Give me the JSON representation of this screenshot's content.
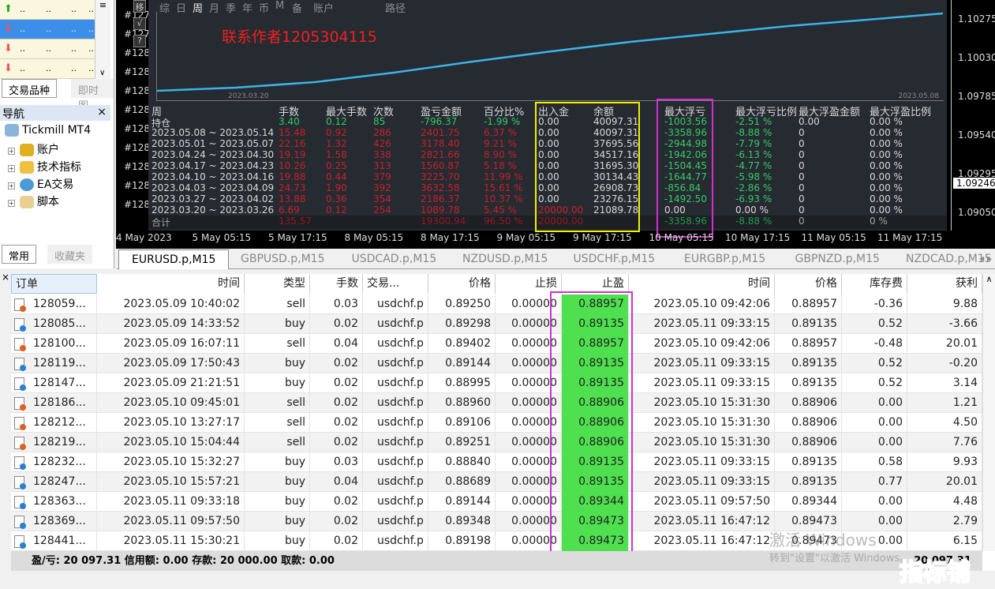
{
  "market_watch": {
    "rows": [
      {
        "dir": "up"
      },
      {
        "dir": "down",
        "selected": true
      },
      {
        "dir": "down"
      },
      {
        "dir": "down"
      }
    ],
    "cell": "..",
    "tabs": [
      "交易品种",
      "即时图"
    ]
  },
  "navigator": {
    "title": "导航",
    "close": "×",
    "root": "Tickmill MT4",
    "items": [
      "账户",
      "技术指标",
      "EA交易",
      "脚本"
    ],
    "tabs": [
      "常用",
      "收藏夹"
    ]
  },
  "chart": {
    "trade_labels": [
      "#127",
      "#127",
      "#128",
      "#128",
      "#128",
      "#128",
      "#128",
      "#128",
      "#128",
      "#128",
      "#128"
    ],
    "tool_buttons": [
      "移",
      "√",
      "?"
    ],
    "panel_tabs": [
      "综",
      "日",
      "周",
      "月",
      "季",
      "年",
      "币",
      "M",
      "备",
      "账户",
      "路径"
    ],
    "watermark": "联系作者1205304115",
    "equity_start_label": "2023.03.20",
    "equity_end_label": "2023.05.08",
    "stats_headers": [
      "周",
      "手数",
      "最大手数",
      "次数",
      "盈亏金额",
      "百分比%",
      "出入金",
      "余额",
      "最大浮亏",
      "最大浮亏比例",
      "最大浮盈金额",
      "最大浮盈比例"
    ],
    "stats_rows": [
      [
        "持仓",
        "3.40",
        "0.12",
        "85",
        "-796.37",
        "-1.99 %",
        "0.00",
        "40097.31",
        "-1003.56",
        "-2.51 %",
        "0.00",
        "0.00 %"
      ],
      [
        "2023.05.08 ~ 2023.05.14",
        "15.48",
        "0.92",
        "286",
        "2401.75",
        "6.37 %",
        "0.00",
        "40097.31",
        "-3358.96",
        "-8.88 %",
        "0",
        "0.00 %"
      ],
      [
        "2023.05.01 ~ 2023.05.07",
        "22.16",
        "1.32",
        "426",
        "3178.40",
        "9.21 %",
        "0.00",
        "37695.56",
        "-2944.98",
        "-7.79 %",
        "0",
        "0.00 %"
      ],
      [
        "2023.04.24 ~ 2023.04.30",
        "19.19",
        "1.58",
        "338",
        "2821.66",
        "8.90 %",
        "0.00",
        "34517.16",
        "-1942.06",
        "-6.13 %",
        "0",
        "0.00 %"
      ],
      [
        "2023.04.17 ~ 2023.04.23",
        "10.26",
        "0.25",
        "313",
        "1560.87",
        "5.18 %",
        "0.00",
        "31695.30",
        "-1504.45",
        "-4.77 %",
        "0",
        "0.00 %"
      ],
      [
        "2023.04.10 ~ 2023.04.16",
        "19.88",
        "0.44",
        "379",
        "3225.70",
        "11.99 %",
        "0.00",
        "30134.43",
        "-1644.77",
        "-5.98 %",
        "0",
        "0.00 %"
      ],
      [
        "2023.04.03 ~ 2023.04.09",
        "24.73",
        "1.90",
        "392",
        "3632.58",
        "15.61 %",
        "0.00",
        "26908.73",
        "-856.84",
        "-2.86 %",
        "0",
        "0.00 %"
      ],
      [
        "2023.03.27 ~ 2023.04.02",
        "13.88",
        "0.36",
        "354",
        "2186.37",
        "10.37 %",
        "0.00",
        "23276.15",
        "-1492.50",
        "-6.93 %",
        "0",
        "0.00 %"
      ],
      [
        "2023.03.20 ~ 2023.03.26",
        "6.69",
        "0.12",
        "254",
        "1089.78",
        "5.45 %",
        "20000.00",
        "21089.78",
        "0.00",
        "0.00 %",
        "0",
        "0.00 %"
      ],
      [
        "合计",
        "135.57",
        "",
        "",
        "19300.94",
        "96.50 %",
        "20000.00",
        "",
        "-3358.96",
        "-8.88 %",
        "0",
        "0 %"
      ]
    ],
    "price_labels": [
      "1.10275",
      "1.10030",
      "1.09785",
      "1.09540",
      "1.09295",
      "1.09050"
    ],
    "current_price": "1.09246",
    "time_labels": [
      "4 May 2023",
      "5 May 05:15",
      "5 May 17:15",
      "8 May 05:15",
      "8 May 17:15",
      "9 May 05:15",
      "9 May 17:15",
      "10 May 05:15",
      "10 May 17:15",
      "11 May 05:15",
      "11 May 17:15"
    ],
    "colors": {
      "equity_line": "#3ab4e8",
      "highlight_yellow": "#f0f000",
      "highlight_magenta": "#d030d0"
    }
  },
  "symbol_tabs": [
    "EURUSD.p,M15",
    "GBPUSD.p,M15",
    "USDCAD.p,M15",
    "NZDUSD.p,M15",
    "USDCHF.p,M15",
    "EURGBP.p,M15",
    "GBPNZD.p,M15",
    "NZDCAD.p,M15"
  ],
  "orders": {
    "headers": [
      "订单",
      "时间",
      "类型",
      "手数",
      "交易...",
      "价格",
      "止损",
      "止盈",
      "时间",
      "价格",
      "库存费",
      "获利"
    ],
    "rows": [
      [
        "128059...",
        "2023.05.09 10:40:02",
        "sell",
        "0.03",
        "usdchf.p",
        "0.89250",
        "0.00000",
        "0.88957",
        "2023.05.10 09:42:06",
        "0.88957",
        "-0.36",
        "9.88"
      ],
      [
        "128085...",
        "2023.05.09 14:33:52",
        "buy",
        "0.02",
        "usdchf.p",
        "0.89298",
        "0.00000",
        "0.89135",
        "2023.05.11 09:33:15",
        "0.89135",
        "0.52",
        "-3.66"
      ],
      [
        "128100...",
        "2023.05.09 16:07:11",
        "sell",
        "0.04",
        "usdchf.p",
        "0.89402",
        "0.00000",
        "0.88957",
        "2023.05.10 09:42:06",
        "0.88957",
        "-0.48",
        "20.01"
      ],
      [
        "128119...",
        "2023.05.09 17:50:43",
        "buy",
        "0.02",
        "usdchf.p",
        "0.89144",
        "0.00000",
        "0.89135",
        "2023.05.11 09:33:15",
        "0.89135",
        "0.52",
        "-0.20"
      ],
      [
        "128147...",
        "2023.05.09 21:21:51",
        "buy",
        "0.02",
        "usdchf.p",
        "0.88995",
        "0.00000",
        "0.89135",
        "2023.05.11 09:33:15",
        "0.89135",
        "0.52",
        "3.14"
      ],
      [
        "128186...",
        "2023.05.10 09:45:01",
        "sell",
        "0.02",
        "usdchf.p",
        "0.88960",
        "0.00000",
        "0.88906",
        "2023.05.10 15:31:30",
        "0.88906",
        "0.00",
        "1.21"
      ],
      [
        "128212...",
        "2023.05.10 13:27:17",
        "sell",
        "0.02",
        "usdchf.p",
        "0.89106",
        "0.00000",
        "0.88906",
        "2023.05.10 15:31:30",
        "0.88906",
        "0.00",
        "4.50"
      ],
      [
        "128219...",
        "2023.05.10 15:04:44",
        "sell",
        "0.02",
        "usdchf.p",
        "0.89251",
        "0.00000",
        "0.88906",
        "2023.05.10 15:31:30",
        "0.88906",
        "0.00",
        "7.76"
      ],
      [
        "128232...",
        "2023.05.10 15:32:27",
        "buy",
        "0.03",
        "usdchf.p",
        "0.88840",
        "0.00000",
        "0.89135",
        "2023.05.11 09:33:15",
        "0.89135",
        "0.58",
        "9.93"
      ],
      [
        "128247...",
        "2023.05.10 15:57:21",
        "buy",
        "0.04",
        "usdchf.p",
        "0.88689",
        "0.00000",
        "0.89135",
        "2023.05.11 09:33:15",
        "0.89135",
        "0.77",
        "20.01"
      ],
      [
        "128363...",
        "2023.05.11 09:33:18",
        "buy",
        "0.02",
        "usdchf.p",
        "0.89144",
        "0.00000",
        "0.89344",
        "2023.05.11 09:57:50",
        "0.89344",
        "0.00",
        "4.48"
      ],
      [
        "128369...",
        "2023.05.11 09:57:50",
        "buy",
        "0.02",
        "usdchf.p",
        "0.89348",
        "0.00000",
        "0.89473",
        "2023.05.11 16:47:12",
        "0.89473",
        "0.00",
        "2.79"
      ],
      [
        "128441...",
        "2023.05.11 15:30:21",
        "buy",
        "0.02",
        "usdchf.p",
        "0.89198",
        "0.00000",
        "0.89473",
        "2023.05.11 16:47:12",
        "0.89473",
        "0.00",
        "6.15"
      ]
    ],
    "summary": "盈/亏: 20 097.31  信用额: 0.00  存款: 20 000.00  取款: 0.00",
    "summary_total": "20 097.31"
  },
  "overlay": {
    "windows_line1": "激活 Windows",
    "windows_line2": "转到\"设置\"以激活 Windows。",
    "logo": "指标铺"
  }
}
